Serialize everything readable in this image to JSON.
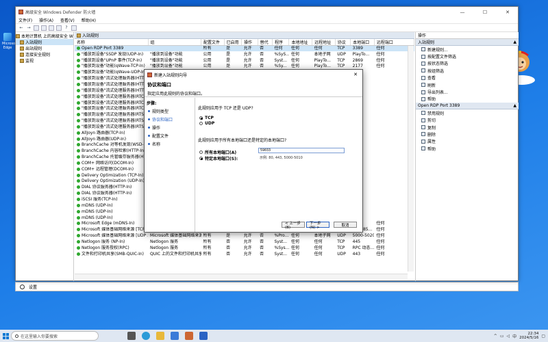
{
  "desktop": {
    "icon_label": "Microsoft Edge",
    "settings_label": "设置"
  },
  "window": {
    "title": "高级安全 Windows Defender 防火墙",
    "controls": [
      "—",
      "☐",
      "✕"
    ]
  },
  "menu": [
    "文件(F)",
    "操作(A)",
    "查看(V)",
    "帮助(H)"
  ],
  "tree": [
    {
      "label": "本地计算机 上的高级安全 Windows",
      "level": 0
    },
    {
      "label": "入站规则",
      "level": 1,
      "selected": true
    },
    {
      "label": "出站规则",
      "level": 1
    },
    {
      "label": "连接安全规则",
      "level": 1
    },
    {
      "label": "监视",
      "level": 1
    }
  ],
  "center": {
    "title": "入站规则",
    "columns": [
      "名称",
      "组",
      "配置文件",
      "已启用",
      "操作",
      "替代",
      "程序",
      "本地地址",
      "远程地址",
      "协议",
      "本地端口",
      "远程端口"
    ],
    "rows": [
      [
        "Open RDP Port 3389",
        "",
        "所有",
        "是",
        "允许",
        "否",
        "任何",
        "任何",
        "任何",
        "TCP",
        "3389",
        "任何"
      ],
      [
        "\"播放到设备\"SSDP 发现(UDP-In)",
        "\"播放到设备\"功能",
        "公用",
        "是",
        "允许",
        "否",
        "%SyS...",
        "任何",
        "本地子网",
        "UDP",
        "PlayTo...",
        "任何"
      ],
      [
        "\"播放到设备\"UPnP 事件(TCP-In)",
        "\"播放到设备\"功能",
        "公用",
        "是",
        "允许",
        "否",
        "Syst...",
        "任何",
        "PlayTo...",
        "TCP",
        "2869",
        "任何"
      ],
      [
        "\"播放到设备\"功能(qWave-TCP-In)",
        "\"播放到设备\"功能",
        "公用",
        "是",
        "允许",
        "否",
        "%Sy...",
        "任何",
        "PlayTo...",
        "TCP",
        "2177",
        "任何"
      ],
      [
        "\"播放到设备\"功能(qWave-UDP-In)",
        "",
        "",
        "",
        "",
        "",
        "",
        "",
        "",
        "",
        "",
        ""
      ],
      [
        "\"播放到设备\"流式处理服务器(HTTP-St",
        "",
        "",
        "",
        "",
        "",
        "",
        "",
        "",
        "",
        "",
        ""
      ],
      [
        "\"播放到设备\"流式处理服务器(HTTP-St",
        "",
        "",
        "",
        "",
        "",
        "",
        "",
        "",
        "",
        "",
        ""
      ],
      [
        "\"播放到设备\"流式处理服务器(HTTP-St",
        "",
        "",
        "",
        "",
        "",
        "",
        "",
        "",
        "",
        "",
        ""
      ],
      [
        "\"播放到设备\"流式处理服务器(RTCP-St",
        "",
        "",
        "",
        "",
        "",
        "",
        "",
        "",
        "",
        "",
        ""
      ],
      [
        "\"播放到设备\"流式处理服务器(RTCP-St",
        "",
        "",
        "",
        "",
        "",
        "",
        "",
        "",
        "",
        "",
        ""
      ],
      [
        "\"播放到设备\"流式处理服务器(RTCP-St",
        "",
        "",
        "",
        "",
        "",
        "",
        "",
        "",
        "",
        "",
        ""
      ],
      [
        "\"播放到设备\"流式处理服务器(RTSP-St",
        "",
        "",
        "",
        "",
        "",
        "",
        "",
        "",
        "",
        "",
        ""
      ],
      [
        "\"播放到设备\"流式处理服务器(RTSP-St",
        "",
        "",
        "",
        "",
        "",
        "",
        "",
        "",
        "",
        "",
        ""
      ],
      [
        "\"播放到设备\"流式处理服务器(RTSP-St",
        "",
        "",
        "",
        "",
        "",
        "",
        "",
        "",
        "",
        "",
        ""
      ],
      [
        "AllJoyn 路由器(TCP-In)",
        "",
        "",
        "",
        "",
        "",
        "",
        "",
        "",
        "",
        "",
        ""
      ],
      [
        "AllJoyn 路由器(UDP-In)",
        "",
        "",
        "",
        "",
        "",
        "",
        "",
        "",
        "",
        "",
        ""
      ],
      [
        "BranchCache 对等机发现(WSD-In)",
        "",
        "",
        "",
        "",
        "",
        "",
        "",
        "",
        "",
        "",
        ""
      ],
      [
        "BranchCache 内容检索(HTTP-In)",
        "",
        "",
        "",
        "",
        "",
        "",
        "",
        "",
        "",
        "",
        ""
      ],
      [
        "BranchCache 托管缓存服务器(HTTP-In",
        "",
        "",
        "",
        "",
        "",
        "",
        "",
        "",
        "",
        "",
        ""
      ],
      [
        "COM+ 网络访问(DCOM-In)",
        "",
        "",
        "",
        "",
        "",
        "",
        "",
        "",
        "",
        "",
        ""
      ],
      [
        "COM+ 远程管理(DCOM-In)",
        "",
        "",
        "",
        "",
        "",
        "",
        "",
        "",
        "",
        "",
        ""
      ],
      [
        "Delivery Optimization (TCP-In)",
        "",
        "",
        "",
        "",
        "",
        "",
        "",
        "",
        "",
        "",
        ""
      ],
      [
        "Delivery Optimization (UDP-In)",
        "",
        "",
        "",
        "",
        "",
        "",
        "",
        "",
        "",
        "",
        ""
      ],
      [
        "DIAL 协议服务器(HTTP-In)",
        "",
        "",
        "",
        "",
        "",
        "",
        "",
        "",
        "",
        "",
        ""
      ],
      [
        "DIAL 协议服务器(HTTP-In)",
        "",
        "",
        "",
        "",
        "",
        "",
        "",
        "",
        "",
        "",
        ""
      ],
      [
        "iSCSI 服务(TCP-In)",
        "",
        "",
        "",
        "",
        "",
        "",
        "",
        "",
        "",
        "",
        ""
      ],
      [
        "mDNS (UDP-In)",
        "",
        "",
        "",
        "",
        "",
        "",
        "",
        "",
        "",
        "",
        ""
      ],
      [
        "mDNS (UDP-In)",
        "",
        "",
        "",
        "",
        "",
        "",
        "",
        "",
        "",
        "",
        ""
      ],
      [
        "mDNS (UDP-In)",
        "",
        "",
        "",
        "",
        "",
        "",
        "",
        "",
        "",
        "",
        ""
      ],
      [
        "Microsoft Edge (mDNS-In)",
        "Microsoft Edge",
        "所有",
        "是",
        "允许",
        "否",
        "C:\\Pr...",
        "任何",
        "任何",
        "UDP",
        "5353",
        "任何"
      ],
      [
        "Microsoft 媒体基础网络来源 [TCP ...",
        "Microsoft 媒体基础网络来源",
        "所有",
        "是",
        "允许",
        "否",
        "%Pro...",
        "任何",
        "本地子网",
        "TCP",
        "554, 85...",
        "任何"
      ],
      [
        "Microsoft 媒体基础网络来源 [UDP ...",
        "Microsoft 媒体基础网络来源",
        "所有",
        "是",
        "允许",
        "否",
        "%Pro...",
        "任何",
        "本地子网",
        "UDP",
        "5000-5020",
        "任何"
      ],
      [
        "Netlogon 服务 (NP-In)",
        "Netlogon 服务",
        "所有",
        "否",
        "允许",
        "否",
        "Syst...",
        "任何",
        "任何",
        "TCP",
        "445",
        "任何"
      ],
      [
        "Netlogon 服务授权(RPC)",
        "Netlogon 服务",
        "所有",
        "否",
        "允许",
        "否",
        "%Sys...",
        "任何",
        "任何",
        "TCP",
        "RPC 动态...",
        "任何"
      ],
      [
        "文件和打印机共享(SMB-QUIC-In)",
        "QUIC 上的文件和打印机共享",
        "所有",
        "否",
        "允许",
        "否",
        "Syst...",
        "任何",
        "任何",
        "UDP",
        "443",
        "任何"
      ]
    ]
  },
  "actions": {
    "header": "操作",
    "section1": "入站规则",
    "items1": [
      "新建规则...",
      "按配置文件筛选",
      "按状态筛选",
      "按组筛选",
      "查看",
      "刷新",
      "导出列表...",
      "帮助"
    ],
    "section2": "Open RDP Port 3389",
    "items2": [
      "禁用规则",
      "剪切",
      "复制",
      "删除",
      "属性",
      "帮助"
    ]
  },
  "dialog": {
    "title": "新建入站规则向导",
    "heading": "协议和端口",
    "subheading": "指定应用此规则的协议和端口。",
    "steps_label": "步骤:",
    "steps": [
      "规则类型",
      "协议和端口",
      "操作",
      "配置文件",
      "名称"
    ],
    "q_protocol": "此规则应用于 TCP 还是 UDP?",
    "opt_tcp": "TCP",
    "opt_udp": "UDP",
    "q_ports": "此规则应用于所有本地端口还是特定的本地端口?",
    "opt_all_ports": "所有本地端口(A)",
    "opt_specific_ports": "特定本地端口(S):",
    "port_value": "59033",
    "port_example": "示例: 80, 443, 5000-5010",
    "btn_back": "< 上一步(B)",
    "btn_next": "下一步(N) >",
    "btn_cancel": "取消"
  },
  "taskbar": {
    "search_placeholder": "在这里输入你要搜索",
    "lang": "中",
    "time": "22:34",
    "date": "2024/5/16"
  },
  "colors": {
    "accent": "#0078d4",
    "selection": "#cce4f7",
    "enabled_green": "#2fa82f"
  }
}
